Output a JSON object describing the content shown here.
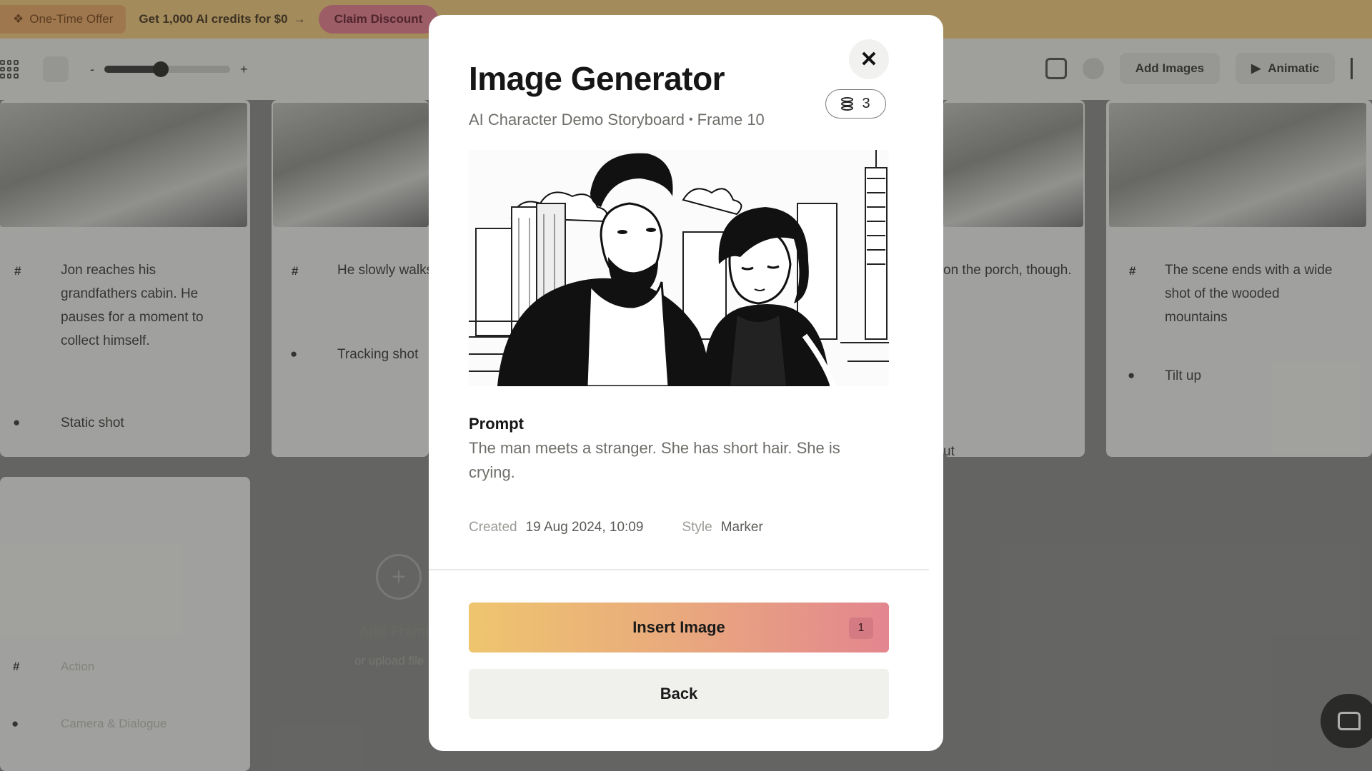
{
  "promo": {
    "badge_text": "One-Time Offer",
    "offer_text": "Get 1,000 AI credits for $0",
    "claim_label": "Claim Discount"
  },
  "toolbar": {
    "zoom_level": 0.45,
    "add_images_label": "Add Images",
    "animatic_label": "Animatic"
  },
  "storyboard": {
    "frames": [
      {
        "description": "Jon reaches his grandfathers cabin. He pauses for a moment to collect himself.",
        "shot": "Static shot"
      },
      {
        "description": "He slowly walks toward the cabin",
        "shot": "Tracking shot"
      },
      {
        "description": "on the porch, though.",
        "shot": "ut"
      },
      {
        "description": "The scene ends with a wide shot of the wooded mountains",
        "shot": "Tilt up"
      }
    ],
    "add_frame_label": "Add Frame",
    "add_frame_sub": "or upload file",
    "action_placeholder": "Action",
    "camera_placeholder": "Camera & Dialogue"
  },
  "modal": {
    "title": "Image Generator",
    "project": "AI Character Demo Storyboard",
    "separator": "•",
    "frame": "Frame 10",
    "credits": "3",
    "close_symbol": "✕",
    "prompt_label": "Prompt",
    "prompt_text": "The man meets a stranger. She has short hair. She is crying.",
    "created_label": "Created",
    "created_value": "19 Aug 2024, 10:09",
    "style_label": "Style",
    "style_value": "Marker",
    "insert_label": "Insert Image",
    "insert_cost": "1",
    "back_label": "Back"
  },
  "colors": {
    "insert_gradient_start": "#eec56e",
    "insert_gradient_end": "#e3868f",
    "promo_bar": "#f0c87e"
  }
}
